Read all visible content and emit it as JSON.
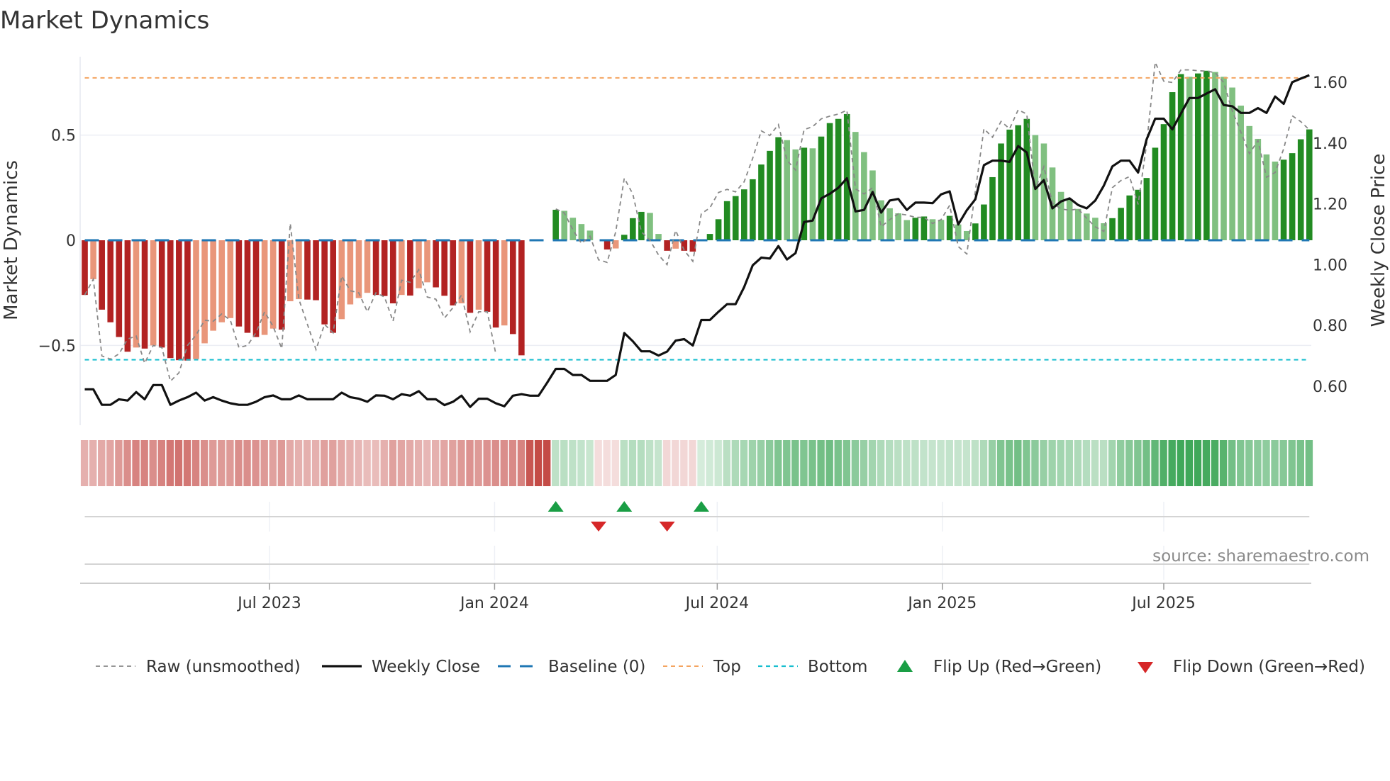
{
  "title": "Market Dynamics",
  "source_note": "source: sharemaestro.com",
  "colors": {
    "bar_red_strong": "#b22222",
    "bar_red_weak": "#e9967a",
    "bar_green_strong": "#228b22",
    "bar_green_weak": "#80c080",
    "raw": "#888888",
    "close": "#111111",
    "baseline": "#1f77b4",
    "top": "#f4a460",
    "bottom": "#17becf",
    "flip_up": "#1a9e45",
    "flip_down": "#d62728"
  },
  "legend": [
    {
      "key": "raw",
      "label": "Raw (unsmoothed)"
    },
    {
      "key": "close",
      "label": "Weekly Close"
    },
    {
      "key": "baseline",
      "label": "Baseline (0)"
    },
    {
      "key": "top",
      "label": "Top"
    },
    {
      "key": "bottom",
      "label": "Bottom"
    },
    {
      "key": "flip_up",
      "label": "Flip Up (Red→Green)"
    },
    {
      "key": "flip_down",
      "label": "Flip Down (Green→Red)"
    }
  ],
  "chart_data": {
    "type": "bar",
    "title": "Market Dynamics",
    "ylabel": "Market Dynamics",
    "ylabel_right": "Weekly Close Price",
    "start_date": "2023-01-31",
    "interval_days": 7,
    "ylim": [
      -0.82,
      0.9
    ],
    "ylim_right": [
      0.47,
      1.68
    ],
    "yticks": [
      {
        "v": 0.5,
        "label": "0.5"
      },
      {
        "v": 0,
        "label": "0"
      },
      {
        "v": -0.5,
        "label": "−0.5"
      }
    ],
    "yticks_right": [
      {
        "v": 0.6,
        "label": "0.60"
      },
      {
        "v": 0.8,
        "label": "0.80"
      },
      {
        "v": 1.0,
        "label": "1.00"
      },
      {
        "v": 1.2,
        "label": "1.20"
      },
      {
        "v": 1.4,
        "label": "1.40"
      },
      {
        "v": 1.6,
        "label": "1.60"
      }
    ],
    "xticks": [
      {
        "date": "2023-07-01",
        "label": "Jul 2023"
      },
      {
        "date": "2024-01-01",
        "label": "Jan 2024"
      },
      {
        "date": "2024-07-01",
        "label": "Jul 2024"
      },
      {
        "date": "2025-01-01",
        "label": "Jan 2025"
      },
      {
        "date": "2025-07-01",
        "label": "Jul 2025"
      }
    ],
    "top_level": 0.772,
    "bottom_level": -0.568,
    "baseline": 0,
    "momentum": [
      -0.26,
      -0.185,
      -0.33,
      -0.39,
      -0.46,
      -0.53,
      -0.51,
      -0.515,
      -0.5,
      -0.51,
      -0.56,
      -0.57,
      -0.572,
      -0.565,
      -0.49,
      -0.43,
      -0.39,
      -0.37,
      -0.41,
      -0.44,
      -0.46,
      -0.45,
      -0.42,
      -0.425,
      -0.29,
      -0.28,
      -0.282,
      -0.285,
      -0.4,
      -0.44,
      -0.375,
      -0.305,
      -0.275,
      -0.25,
      -0.26,
      -0.265,
      -0.3,
      -0.26,
      -0.263,
      -0.228,
      -0.2,
      -0.224,
      -0.264,
      -0.31,
      -0.3,
      -0.345,
      -0.33,
      -0.34,
      -0.415,
      -0.405,
      -0.446,
      -0.547,
      0,
      0,
      0,
      0.145,
      0.14,
      0.107,
      0.077,
      0.046,
      0,
      -0.044,
      -0.039,
      0.026,
      0.105,
      0.135,
      0.13,
      0.03,
      -0.05,
      -0.04,
      -0.05,
      -0.054,
      0.005,
      0.03,
      0.1,
      0.186,
      0.21,
      0.242,
      0.29,
      0.36,
      0.425,
      0.49,
      0.476,
      0.432,
      0.44,
      0.437,
      0.493,
      0.557,
      0.577,
      0.6,
      0.515,
      0.419,
      0.332,
      0.19,
      0.152,
      0.128,
      0.096,
      0.107,
      0.113,
      0.1,
      0.097,
      0.116,
      0.075,
      0.044,
      0.08,
      0.17,
      0.3,
      0.46,
      0.526,
      0.547,
      0.577,
      0.5,
      0.46,
      0.346,
      0.23,
      0.194,
      0.149,
      0.127,
      0.107,
      0.081,
      0.105,
      0.154,
      0.213,
      0.24,
      0.296,
      0.44,
      0.552,
      0.704,
      0.79,
      0.777,
      0.793,
      0.806,
      0.8,
      0.777,
      0.726,
      0.64,
      0.543,
      0.482,
      0.408,
      0.374,
      0.383,
      0.414,
      0.48,
      0.527
    ],
    "raw": [
      -0.26,
      -0.185,
      -0.55,
      -0.565,
      -0.54,
      -0.47,
      -0.455,
      -0.585,
      -0.5,
      -0.51,
      -0.67,
      -0.63,
      -0.5,
      -0.45,
      -0.38,
      -0.385,
      -0.35,
      -0.38,
      -0.51,
      -0.5,
      -0.44,
      -0.34,
      -0.41,
      -0.515,
      0.08,
      -0.28,
      -0.4,
      -0.52,
      -0.4,
      -0.44,
      -0.17,
      -0.24,
      -0.25,
      -0.34,
      -0.25,
      -0.27,
      -0.385,
      -0.19,
      -0.2,
      -0.14,
      -0.27,
      -0.28,
      -0.37,
      -0.32,
      -0.26,
      -0.435,
      -0.34,
      -0.34,
      -0.54,
      null,
      null,
      null,
      null,
      null,
      null,
      0.149,
      0.13,
      0.05,
      -0.015,
      0.02,
      -0.093,
      -0.105,
      0.04,
      0.295,
      0.22,
      0.04,
      0,
      -0.07,
      -0.116,
      0.047,
      -0.048,
      -0.1,
      0.126,
      0.154,
      0.227,
      0.242,
      0.23,
      0.278,
      0.39,
      0.52,
      0.498,
      0.55,
      0.38,
      0.334,
      0.526,
      0.54,
      0.577,
      0.59,
      0.6,
      0.618,
      0.244,
      0.22,
      0.25,
      0.064,
      0.098,
      0.126,
      0.12,
      0.109,
      0.109,
      0.08,
      0.098,
      0.166,
      -0.03,
      -0.065,
      0.233,
      0.53,
      0.49,
      0.565,
      0.53,
      0.62,
      0.6,
      0.244,
      0.35,
      0.177,
      0.149,
      0.143,
      0.149,
      0.104,
      0.064,
      0.042,
      0.25,
      0.284,
      0.303,
      0.17,
      0.457,
      0.846,
      0.756,
      0.75,
      0.81,
      0.81,
      0.806,
      0.804,
      0.797,
      0.75,
      0.615,
      0.514,
      0.412,
      0.474,
      0.3,
      0.322,
      0.435,
      0.592,
      0.564,
      0.525
    ],
    "weekly_close": [
      0.59,
      0.59,
      0.539,
      0.539,
      0.557,
      0.553,
      0.581,
      0.557,
      0.604,
      0.604,
      0.539,
      0.553,
      0.564,
      0.579,
      0.553,
      0.564,
      0.553,
      0.544,
      0.539,
      0.539,
      0.549,
      0.564,
      0.57,
      0.557,
      0.557,
      0.57,
      0.557,
      0.557,
      0.557,
      0.557,
      0.579,
      0.564,
      0.559,
      0.549,
      0.57,
      0.569,
      0.557,
      0.574,
      0.569,
      0.584,
      0.557,
      0.557,
      0.538,
      0.549,
      0.569,
      0.532,
      0.559,
      0.559,
      0.544,
      0.534,
      0.569,
      0.574,
      0.569,
      0.569,
      0.612,
      0.657,
      0.657,
      0.637,
      0.637,
      0.618,
      0.618,
      0.618,
      0.637,
      0.775,
      0.748,
      0.715,
      0.715,
      0.701,
      0.714,
      0.75,
      0.755,
      0.734,
      0.818,
      0.818,
      0.845,
      0.87,
      0.87,
      0.926,
      0.998,
      1.023,
      1.02,
      1.061,
      1.017,
      1.038,
      1.14,
      1.145,
      1.218,
      1.233,
      1.253,
      1.284,
      1.175,
      1.18,
      1.239,
      1.171,
      1.211,
      1.216,
      1.18,
      1.204,
      1.204,
      1.202,
      1.231,
      1.241,
      1.132,
      1.179,
      1.215,
      1.327,
      1.342,
      1.342,
      1.338,
      1.39,
      1.369,
      1.249,
      1.278,
      1.185,
      1.208,
      1.218,
      1.196,
      1.185,
      1.211,
      1.26,
      1.323,
      1.342,
      1.342,
      1.303,
      1.412,
      1.48,
      1.48,
      1.445,
      1.497,
      1.548,
      1.548,
      1.563,
      1.577,
      1.525,
      1.521,
      1.499,
      1.499,
      1.515,
      1.499,
      1.553,
      1.529,
      1.6,
      1.612,
      1.623
    ],
    "regime_strength": [
      -0.35,
      -0.35,
      -0.38,
      -0.4,
      -0.45,
      -0.5,
      -0.55,
      -0.55,
      -0.5,
      -0.55,
      -0.6,
      -0.62,
      -0.6,
      -0.55,
      -0.5,
      -0.45,
      -0.45,
      -0.45,
      -0.5,
      -0.5,
      -0.48,
      -0.45,
      -0.42,
      -0.45,
      -0.38,
      -0.35,
      -0.35,
      -0.35,
      -0.42,
      -0.42,
      -0.38,
      -0.35,
      -0.32,
      -0.3,
      -0.3,
      -0.35,
      -0.42,
      -0.4,
      -0.38,
      -0.35,
      -0.32,
      -0.35,
      -0.4,
      -0.42,
      -0.45,
      -0.48,
      -0.45,
      -0.48,
      -0.5,
      -0.5,
      -0.52,
      -0.55,
      -0.75,
      -0.8,
      -0.8,
      0.28,
      0.3,
      0.28,
      0.26,
      0.24,
      -0.15,
      -0.15,
      -0.15,
      0.3,
      0.32,
      0.32,
      0.28,
      0.25,
      -0.18,
      -0.18,
      -0.18,
      -0.18,
      0.18,
      0.2,
      0.22,
      0.3,
      0.35,
      0.38,
      0.42,
      0.45,
      0.5,
      0.55,
      0.55,
      0.58,
      0.55,
      0.58,
      0.6,
      0.62,
      0.58,
      0.55,
      0.5,
      0.45,
      0.4,
      0.35,
      0.32,
      0.3,
      0.28,
      0.28,
      0.26,
      0.25,
      0.25,
      0.26,
      0.25,
      0.25,
      0.28,
      0.35,
      0.45,
      0.55,
      0.58,
      0.6,
      0.55,
      0.5,
      0.45,
      0.42,
      0.4,
      0.38,
      0.35,
      0.32,
      0.3,
      0.3,
      0.4,
      0.48,
      0.52,
      0.55,
      0.6,
      0.68,
      0.75,
      0.8,
      0.82,
      0.82,
      0.82,
      0.8,
      0.78,
      0.72,
      0.6,
      0.55,
      0.52,
      0.5,
      0.48,
      0.5,
      0.52,
      0.55,
      0.58,
      0.6
    ],
    "flip_up_weeks": [
      56,
      64,
      73
    ],
    "flip_down_weeks": [
      61,
      69
    ]
  }
}
